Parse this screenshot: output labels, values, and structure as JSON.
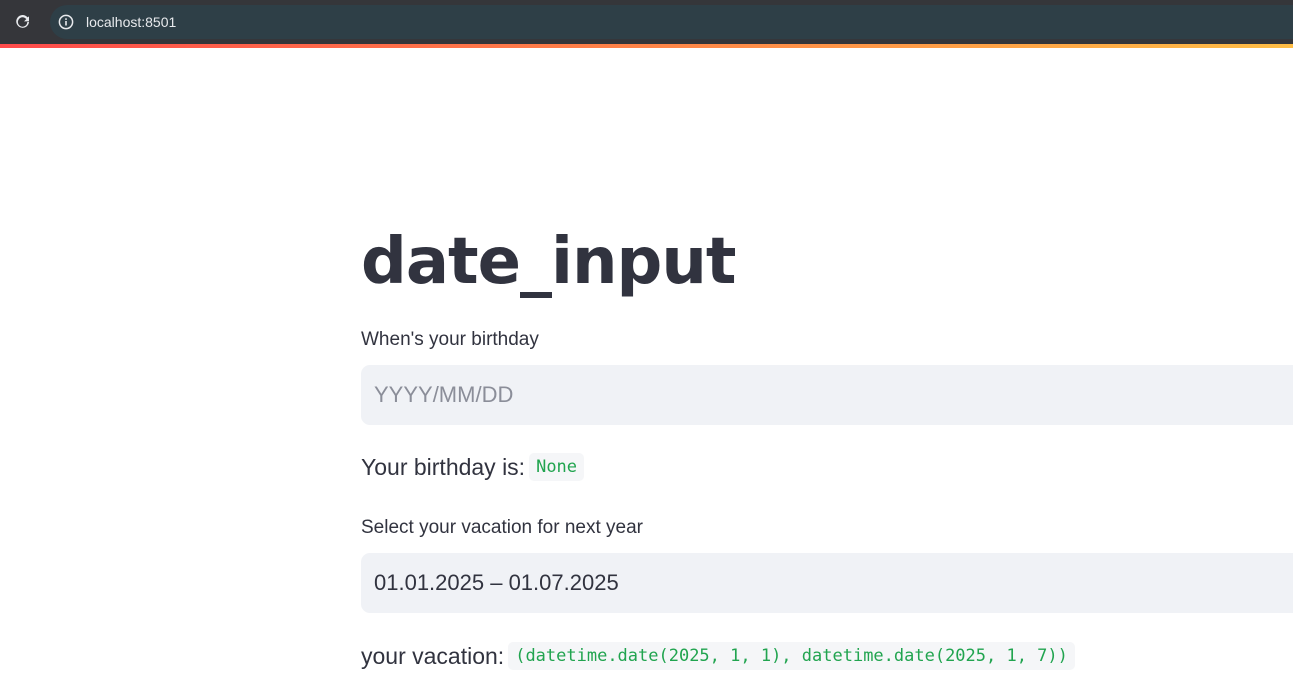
{
  "browser": {
    "url": "localhost:8501",
    "reload_icon": "reload-icon",
    "info_icon": "info-icon"
  },
  "colors": {
    "accent_red": "#ff4b4b",
    "accent_yellow": "#ffbd45",
    "code_green": "#21a44f",
    "text": "#31333f",
    "input_bg": "#f0f2f6"
  },
  "page": {
    "title": "date_input"
  },
  "birthday": {
    "label": "When's your birthday",
    "placeholder": "YYYY/MM/DD",
    "value": "",
    "output_label": "Your birthday is:",
    "output_value": "None"
  },
  "vacation": {
    "label": "Select your vacation for next year",
    "value": "01.01.2025 – 01.07.2025",
    "output_label": "your vacation:",
    "output_value": "(datetime.date(2025, 1, 1), datetime.date(2025, 1, 7))"
  }
}
